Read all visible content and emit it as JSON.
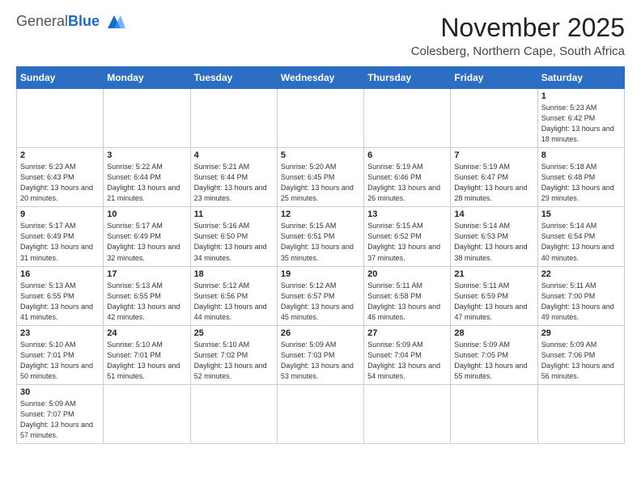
{
  "header": {
    "logo_general": "General",
    "logo_blue": "Blue",
    "month_title": "November 2025",
    "location": "Colesberg, Northern Cape, South Africa"
  },
  "days_of_week": [
    "Sunday",
    "Monday",
    "Tuesday",
    "Wednesday",
    "Thursday",
    "Friday",
    "Saturday"
  ],
  "weeks": [
    [
      {
        "day": "",
        "info": ""
      },
      {
        "day": "",
        "info": ""
      },
      {
        "day": "",
        "info": ""
      },
      {
        "day": "",
        "info": ""
      },
      {
        "day": "",
        "info": ""
      },
      {
        "day": "",
        "info": ""
      },
      {
        "day": "1",
        "info": "Sunrise: 5:23 AM\nSunset: 6:42 PM\nDaylight: 13 hours\nand 18 minutes."
      }
    ],
    [
      {
        "day": "2",
        "info": "Sunrise: 5:23 AM\nSunset: 6:43 PM\nDaylight: 13 hours\nand 20 minutes."
      },
      {
        "day": "3",
        "info": "Sunrise: 5:22 AM\nSunset: 6:44 PM\nDaylight: 13 hours\nand 21 minutes."
      },
      {
        "day": "4",
        "info": "Sunrise: 5:21 AM\nSunset: 6:44 PM\nDaylight: 13 hours\nand 23 minutes."
      },
      {
        "day": "5",
        "info": "Sunrise: 5:20 AM\nSunset: 6:45 PM\nDaylight: 13 hours\nand 25 minutes."
      },
      {
        "day": "6",
        "info": "Sunrise: 5:19 AM\nSunset: 6:46 PM\nDaylight: 13 hours\nand 26 minutes."
      },
      {
        "day": "7",
        "info": "Sunrise: 5:19 AM\nSunset: 6:47 PM\nDaylight: 13 hours\nand 28 minutes."
      },
      {
        "day": "8",
        "info": "Sunrise: 5:18 AM\nSunset: 6:48 PM\nDaylight: 13 hours\nand 29 minutes."
      }
    ],
    [
      {
        "day": "9",
        "info": "Sunrise: 5:17 AM\nSunset: 6:49 PM\nDaylight: 13 hours\nand 31 minutes."
      },
      {
        "day": "10",
        "info": "Sunrise: 5:17 AM\nSunset: 6:49 PM\nDaylight: 13 hours\nand 32 minutes."
      },
      {
        "day": "11",
        "info": "Sunrise: 5:16 AM\nSunset: 6:50 PM\nDaylight: 13 hours\nand 34 minutes."
      },
      {
        "day": "12",
        "info": "Sunrise: 5:15 AM\nSunset: 6:51 PM\nDaylight: 13 hours\nand 35 minutes."
      },
      {
        "day": "13",
        "info": "Sunrise: 5:15 AM\nSunset: 6:52 PM\nDaylight: 13 hours\nand 37 minutes."
      },
      {
        "day": "14",
        "info": "Sunrise: 5:14 AM\nSunset: 6:53 PM\nDaylight: 13 hours\nand 38 minutes."
      },
      {
        "day": "15",
        "info": "Sunrise: 5:14 AM\nSunset: 6:54 PM\nDaylight: 13 hours\nand 40 minutes."
      }
    ],
    [
      {
        "day": "16",
        "info": "Sunrise: 5:13 AM\nSunset: 6:55 PM\nDaylight: 13 hours\nand 41 minutes."
      },
      {
        "day": "17",
        "info": "Sunrise: 5:13 AM\nSunset: 6:55 PM\nDaylight: 13 hours\nand 42 minutes."
      },
      {
        "day": "18",
        "info": "Sunrise: 5:12 AM\nSunset: 6:56 PM\nDaylight: 13 hours\nand 44 minutes."
      },
      {
        "day": "19",
        "info": "Sunrise: 5:12 AM\nSunset: 6:57 PM\nDaylight: 13 hours\nand 45 minutes."
      },
      {
        "day": "20",
        "info": "Sunrise: 5:11 AM\nSunset: 6:58 PM\nDaylight: 13 hours\nand 46 minutes."
      },
      {
        "day": "21",
        "info": "Sunrise: 5:11 AM\nSunset: 6:59 PM\nDaylight: 13 hours\nand 47 minutes."
      },
      {
        "day": "22",
        "info": "Sunrise: 5:11 AM\nSunset: 7:00 PM\nDaylight: 13 hours\nand 49 minutes."
      }
    ],
    [
      {
        "day": "23",
        "info": "Sunrise: 5:10 AM\nSunset: 7:01 PM\nDaylight: 13 hours\nand 50 minutes."
      },
      {
        "day": "24",
        "info": "Sunrise: 5:10 AM\nSunset: 7:01 PM\nDaylight: 13 hours\nand 51 minutes."
      },
      {
        "day": "25",
        "info": "Sunrise: 5:10 AM\nSunset: 7:02 PM\nDaylight: 13 hours\nand 52 minutes."
      },
      {
        "day": "26",
        "info": "Sunrise: 5:09 AM\nSunset: 7:03 PM\nDaylight: 13 hours\nand 53 minutes."
      },
      {
        "day": "27",
        "info": "Sunrise: 5:09 AM\nSunset: 7:04 PM\nDaylight: 13 hours\nand 54 minutes."
      },
      {
        "day": "28",
        "info": "Sunrise: 5:09 AM\nSunset: 7:05 PM\nDaylight: 13 hours\nand 55 minutes."
      },
      {
        "day": "29",
        "info": "Sunrise: 5:09 AM\nSunset: 7:06 PM\nDaylight: 13 hours\nand 56 minutes."
      }
    ],
    [
      {
        "day": "30",
        "info": "Sunrise: 5:09 AM\nSunset: 7:07 PM\nDaylight: 13 hours\nand 57 minutes."
      },
      {
        "day": "",
        "info": ""
      },
      {
        "day": "",
        "info": ""
      },
      {
        "day": "",
        "info": ""
      },
      {
        "day": "",
        "info": ""
      },
      {
        "day": "",
        "info": ""
      },
      {
        "day": "",
        "info": ""
      }
    ]
  ]
}
